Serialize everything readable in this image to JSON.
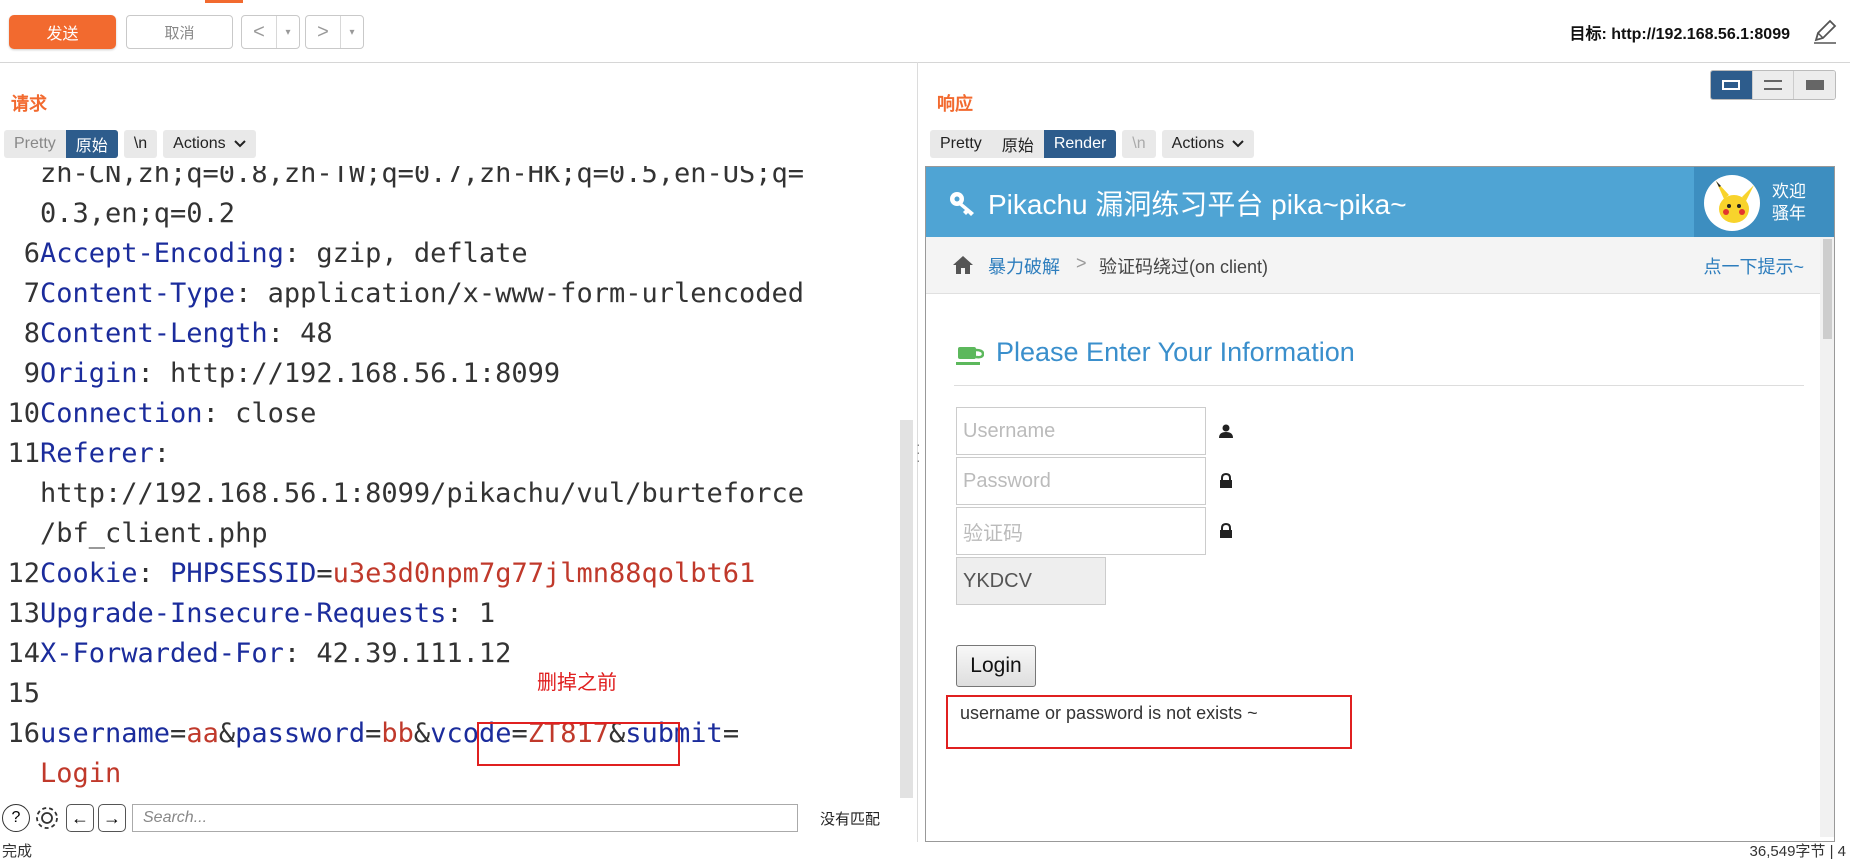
{
  "toolbar": {
    "send_label": "发送",
    "cancel_label": "取消",
    "back_label": "<",
    "forward_label": ">",
    "dropdown_label": "▾",
    "target": "目标: http://192.168.56.1:8099"
  },
  "request": {
    "title": "请求",
    "tabs": [
      "Pretty",
      "原始"
    ],
    "active_tab": "原始",
    "newline_label": "\\n",
    "actions_label": "Actions",
    "lines": [
      {
        "num": "",
        "parts": [
          {
            "t": "zh-CN,zh;q=0.8,zh-TW;q=0.7,zh-HK;q=0.5,en-US;q=",
            "c": "v"
          }
        ]
      },
      {
        "num": "",
        "parts": [
          {
            "t": "0.3,en;q=0.2",
            "c": "v"
          }
        ]
      },
      {
        "num": "6",
        "parts": [
          {
            "t": "Accept-Encoding",
            "c": "k"
          },
          {
            "t": ": gzip, deflate",
            "c": "v"
          }
        ]
      },
      {
        "num": "7",
        "parts": [
          {
            "t": "Content-Type",
            "c": "k"
          },
          {
            "t": ": application/x-www-form-urlencoded",
            "c": "v"
          }
        ]
      },
      {
        "num": "8",
        "parts": [
          {
            "t": "Content-Length",
            "c": "k"
          },
          {
            "t": ": 48",
            "c": "v"
          }
        ]
      },
      {
        "num": "9",
        "parts": [
          {
            "t": "Origin",
            "c": "k"
          },
          {
            "t": ": http://192.168.56.1:8099",
            "c": "v"
          }
        ]
      },
      {
        "num": "10",
        "parts": [
          {
            "t": "Connection",
            "c": "k"
          },
          {
            "t": ": close",
            "c": "v"
          }
        ]
      },
      {
        "num": "11",
        "parts": [
          {
            "t": "Referer",
            "c": "k"
          },
          {
            "t": ":",
            "c": "v"
          }
        ]
      },
      {
        "num": "",
        "parts": [
          {
            "t": "http://192.168.56.1:8099/pikachu/vul/burteforce",
            "c": "v"
          }
        ]
      },
      {
        "num": "",
        "parts": [
          {
            "t": "/bf_client.php",
            "c": "v"
          }
        ]
      },
      {
        "num": "12",
        "parts": [
          {
            "t": "Cookie",
            "c": "k"
          },
          {
            "t": ": ",
            "c": "v"
          },
          {
            "t": "PHPSESSID",
            "c": "k"
          },
          {
            "t": "=",
            "c": "v"
          },
          {
            "t": "u3e3d0npm7g77jlmn88qolbt61",
            "c": "r"
          }
        ]
      },
      {
        "num": "13",
        "parts": [
          {
            "t": "Upgrade-Insecure-Requests",
            "c": "k"
          },
          {
            "t": ": 1",
            "c": "v"
          }
        ]
      },
      {
        "num": "14",
        "parts": [
          {
            "t": "X-Forwarded-For",
            "c": "k"
          },
          {
            "t": ": 42.39.111.12",
            "c": "v"
          }
        ]
      },
      {
        "num": "15",
        "parts": []
      },
      {
        "num": "16",
        "parts": [
          {
            "t": "username",
            "c": "k"
          },
          {
            "t": "=",
            "c": "v"
          },
          {
            "t": "aa",
            "c": "r"
          },
          {
            "t": "&",
            "c": "v"
          },
          {
            "t": "password",
            "c": "k"
          },
          {
            "t": "=",
            "c": "v"
          },
          {
            "t": "bb",
            "c": "r"
          },
          {
            "t": "&",
            "c": "v"
          },
          {
            "t": "vcode",
            "c": "k"
          },
          {
            "t": "=",
            "c": "v"
          },
          {
            "t": "ZT817",
            "c": "r"
          },
          {
            "t": "&",
            "c": "v"
          },
          {
            "t": "submit",
            "c": "k"
          },
          {
            "t": "=",
            "c": "v"
          }
        ]
      },
      {
        "num": "",
        "parts": [
          {
            "t": "Login",
            "c": "r"
          }
        ]
      }
    ],
    "annotation": "删掉之前",
    "search_placeholder": "Search...",
    "search_status": "没有匹配"
  },
  "response": {
    "title": "响应",
    "tabs": [
      "Pretty",
      "原始",
      "Render"
    ],
    "active_tab": "Render",
    "newline_label": "\\n",
    "actions_label": "Actions",
    "render": {
      "site_title": "Pikachu 漏洞练习平台 pika~pika~",
      "greeting_1": "欢迎",
      "greeting_2": "骚年",
      "crumb_1": "暴力破解",
      "crumb_sep": ">",
      "crumb_2": "验证码绕过(on client)",
      "hint": "点一下提示~",
      "form_title": "Please Enter Your Information",
      "username_placeholder": "Username",
      "password_placeholder": "Password",
      "vcode_placeholder": "验证码",
      "captcha": "YKDCV",
      "login_label": "Login",
      "message": "username or password is not exists ~"
    }
  },
  "status": {
    "left": "完成",
    "right": "36,549字节 | 4"
  },
  "colors": {
    "accent": "#f26a2f",
    "active_tab": "#2d5c8c",
    "header_key": "#1b2c9c",
    "value_red": "#c0392b",
    "pikachu_blue": "#4fa4d4",
    "highlight": "#e02020"
  }
}
